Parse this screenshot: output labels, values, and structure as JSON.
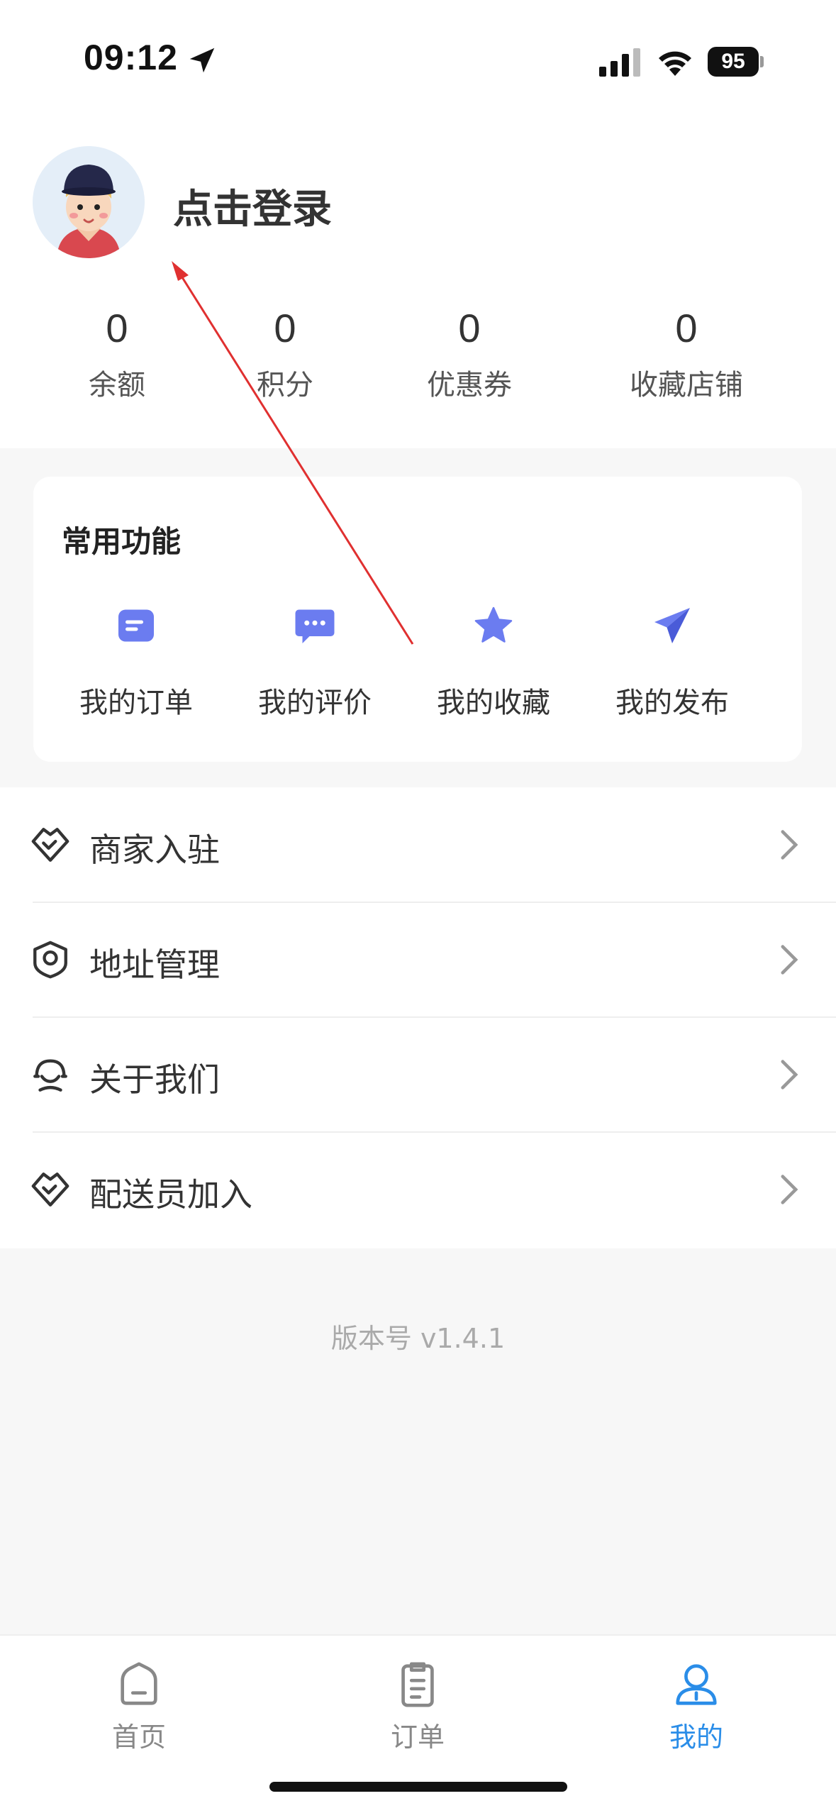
{
  "status_bar": {
    "time": "09:12",
    "battery": "95"
  },
  "profile": {
    "login_prompt": "点击登录"
  },
  "stats": [
    {
      "value": "0",
      "label": "余额"
    },
    {
      "value": "0",
      "label": "积分"
    },
    {
      "value": "0",
      "label": "优惠券"
    },
    {
      "value": "0",
      "label": "收藏店铺"
    }
  ],
  "common_functions": {
    "title": "常用功能",
    "items": [
      {
        "label": "我的订单",
        "icon": "order-card-icon"
      },
      {
        "label": "我的评价",
        "icon": "chat-bubble-icon"
      },
      {
        "label": "我的收藏",
        "icon": "star-icon"
      },
      {
        "label": "我的发布",
        "icon": "paper-plane-icon"
      }
    ]
  },
  "menu": [
    {
      "label": "商家入驻",
      "icon": "handshake-icon"
    },
    {
      "label": "地址管理",
      "icon": "location-pin-icon"
    },
    {
      "label": "关于我们",
      "icon": "support-agent-icon"
    },
    {
      "label": "配送员加入",
      "icon": "handshake-icon"
    }
  ],
  "version": "版本号 v1.4.1",
  "tabbar": [
    {
      "label": "首页",
      "icon": "home-icon"
    },
    {
      "label": "订单",
      "icon": "clipboard-icon"
    },
    {
      "label": "我的",
      "icon": "person-icon",
      "active": true
    }
  ],
  "colors": {
    "accent": "#2a8de8",
    "icon_purple": "#6b7cf0",
    "annotation": "#e03030"
  }
}
